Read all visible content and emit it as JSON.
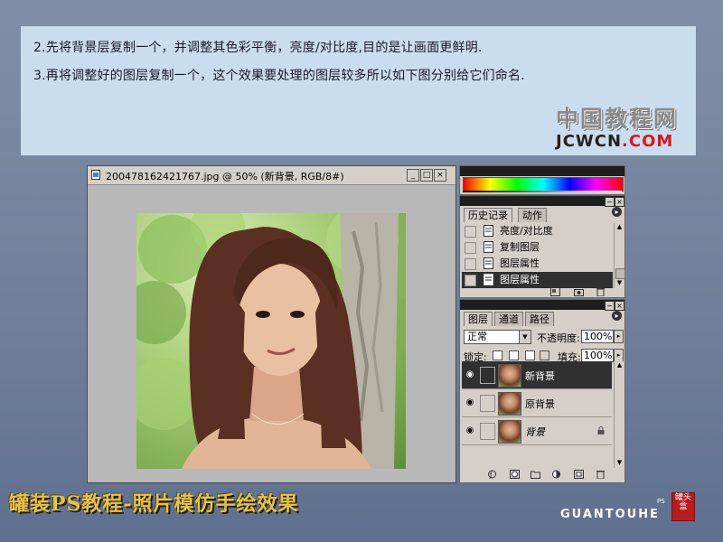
{
  "instructions": {
    "line1": "2.先将背景层复制一个，并调整其色彩平衡，亮度/对比度,目的是让画面更鲜明.",
    "line2": "3.再将调整好的图层复制一个，这个效果要处理的图层较多所以如下图分别给它们命名."
  },
  "site_logo": {
    "chinese": "中国教程网",
    "domain_part1": "JCWCN",
    "domain_part2": ".COM"
  },
  "image_window": {
    "title": "200478162421767.jpg @ 50% (新背景, RGB/8#)",
    "minimize": "_",
    "maximize": "□",
    "close": "×"
  },
  "history_panel": {
    "tabs": [
      "历史记录",
      "动作"
    ],
    "items": [
      {
        "label": "亮度/对比度",
        "active": false
      },
      {
        "label": "复制图层",
        "active": false
      },
      {
        "label": "图层属性",
        "active": false
      },
      {
        "label": "图层属性",
        "active": true
      }
    ]
  },
  "layers_panel": {
    "tabs": [
      "图层",
      "通道",
      "路径"
    ],
    "blend_mode": "正常",
    "opacity_label": "不透明度:",
    "opacity_value": "100%",
    "lock_label": "锁定:",
    "fill_label": "填充:",
    "fill_value": "100%",
    "layers": [
      {
        "name": "新背景",
        "active": true,
        "locked": false
      },
      {
        "name": "原背景",
        "active": false,
        "locked": false
      },
      {
        "name": "背景",
        "active": false,
        "locked": true
      }
    ]
  },
  "footer": {
    "title": "罐装PS教程-照片模仿手绘效果",
    "brand": "GUANTOUHE",
    "brand_ps": "PS",
    "seal_text": "罐头盒"
  },
  "colors": {
    "accent_red": "#e0141b",
    "panel_bg": "#c9ddee",
    "title_gold": "#e7c341"
  }
}
